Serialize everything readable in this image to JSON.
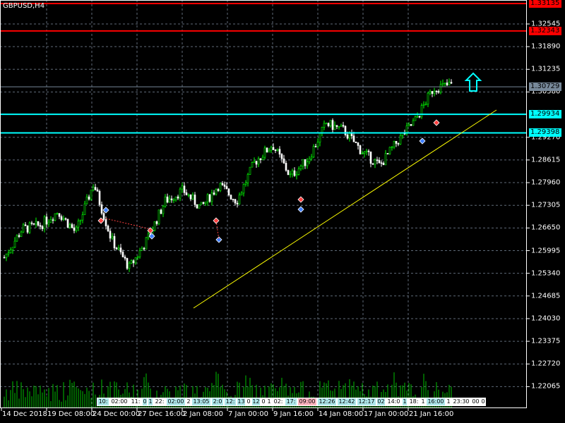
{
  "symbol_title": "GBPUSD,H4",
  "colors": {
    "bull": "#00ff00",
    "bear": "#ffffff",
    "grid": "#5f6a78",
    "volume": "#00c000",
    "trendline": "#ffff00",
    "resistance": "#ff0000",
    "support": "#00ffff",
    "bid_line": "#778899"
  },
  "price_axis": {
    "labels": [
      "1.32545",
      "1.31890",
      "1.31235",
      "1.30580",
      "1.29270",
      "1.28615",
      "1.27960",
      "1.27305",
      "1.26650",
      "1.25995",
      "1.25340",
      "1.24685",
      "1.24030",
      "1.23375",
      "1.22720",
      "1.22065"
    ],
    "step": 0.00655,
    "top_label_price": 1.32545
  },
  "price_tags": [
    {
      "value": "1.33135",
      "kind": "resistance",
      "bg": "#ff0000",
      "fg": "#000000"
    },
    {
      "value": "1.32343",
      "kind": "resistance",
      "bg": "#ff0000",
      "fg": "#000000"
    },
    {
      "value": "1.30729",
      "kind": "bid",
      "bg": "#778899",
      "fg": "#000000"
    },
    {
      "value": "1.29934",
      "kind": "support",
      "bg": "#00ffff",
      "fg": "#000000"
    },
    {
      "value": "1.29398",
      "kind": "support",
      "bg": "#00ffff",
      "fg": "#000000"
    }
  ],
  "time_axis": [
    "14 Dec 2018",
    "19 Dec 08:00",
    "24 Dec 00:00",
    "27 Dec 16:00",
    "2 Jan 08:00",
    "7 Jan 00:00",
    "9 Jan 16:00",
    "14 Jan 08:00",
    "17 Jan 00:00",
    "21 Jan 16:00"
  ],
  "event_tags": [
    {
      "text": "10:",
      "bg": "#b0e8ec"
    },
    {
      "text": "02:00",
      "bg": "#ffffff"
    },
    {
      "text": "11:",
      "bg": "#ffffff"
    },
    {
      "text": "0",
      "bg": "#b0e8ec"
    },
    {
      "text": "1",
      "bg": "#b0e8ec"
    },
    {
      "text": "22:",
      "bg": "#ffffff"
    },
    {
      "text": "02:00",
      "bg": "#b0e8ec"
    },
    {
      "text": "2",
      "bg": "#ffffff"
    },
    {
      "text": "13:05",
      "bg": "#b0e8ec"
    },
    {
      "text": "2:0",
      "bg": "#b0e8ec"
    },
    {
      "text": "12:",
      "bg": "#b0e8ec"
    },
    {
      "text": "13",
      "bg": "#b0e8ec"
    },
    {
      "text": "0",
      "bg": "#ffffff"
    },
    {
      "text": "12",
      "bg": "#b0e8ec"
    },
    {
      "text": "0",
      "bg": "#ffffff"
    },
    {
      "text": "1",
      "bg": "#ffffff"
    },
    {
      "text": "02:",
      "bg": "#ffffff"
    },
    {
      "text": "17:",
      "bg": "#b0e8ec"
    },
    {
      "text": "09:00",
      "bg": "#ffb6c1"
    },
    {
      "text": "12:26",
      "bg": "#b0e8ec"
    },
    {
      "text": "12:42",
      "bg": "#b0e8ec"
    },
    {
      "text": "12:17",
      "bg": "#b0e8ec"
    },
    {
      "text": "02",
      "bg": "#b0e8ec"
    },
    {
      "text": "14:0",
      "bg": "#ffffff"
    },
    {
      "text": "1",
      "bg": "#b0e8ec"
    },
    {
      "text": "18:",
      "bg": "#ffffff"
    },
    {
      "text": "1",
      "bg": "#ffffff"
    },
    {
      "text": "16:00",
      "bg": "#b0e8ec"
    },
    {
      "text": "1",
      "bg": "#ffffff"
    },
    {
      "text": "23:30",
      "bg": "#ffffff"
    },
    {
      "text": "00",
      "bg": "#ffffff"
    },
    {
      "text": "0",
      "bg": "#ffffff"
    }
  ],
  "price_path": [
    1.258,
    1.2662,
    1.2672,
    1.2713,
    1.2652,
    1.2794,
    1.2631,
    1.255,
    1.2631,
    1.2743,
    1.2774,
    1.2723,
    1.279,
    1.2743,
    1.2855,
    1.2906,
    1.2814,
    1.2865,
    1.2967,
    1.2947,
    1.2886,
    1.2845,
    1.2916,
    1.2977,
    1.3069,
    1.3079
  ],
  "trendline": {
    "from_price": 1.2443,
    "to_price": 1.301
  },
  "signal_arrow": "up-arrow"
}
